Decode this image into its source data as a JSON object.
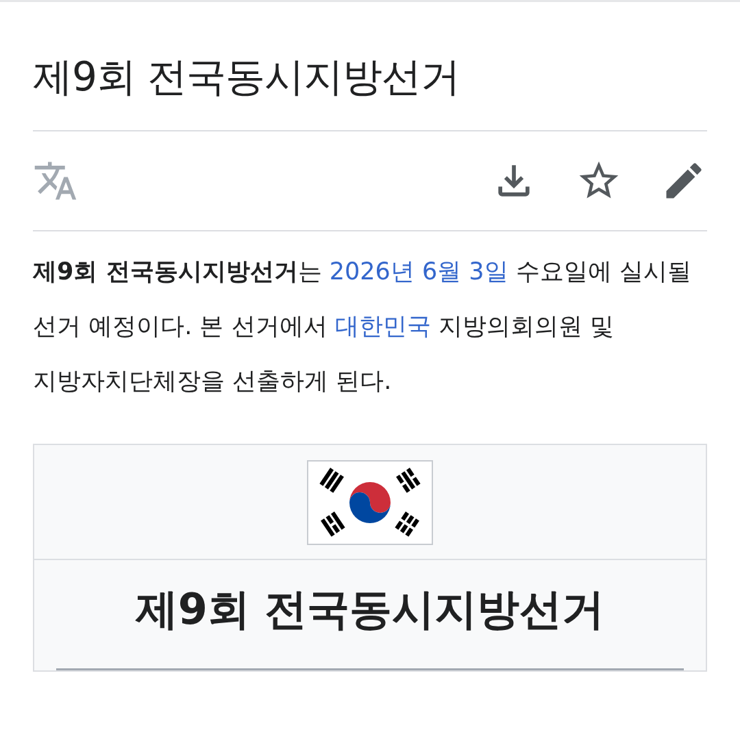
{
  "page_title": "제9회 전국동시지방선거",
  "toolbar": {
    "actions": [
      {
        "kind": "download"
      },
      {
        "kind": "star"
      },
      {
        "kind": "edit"
      }
    ]
  },
  "lead": [
    {
      "kind": "bold",
      "text": "제9회 전국동시지방선거"
    },
    {
      "kind": "text",
      "text": "는 "
    },
    {
      "kind": "link",
      "text": "2026년 6월 3일"
    },
    {
      "kind": "text",
      "text": " 수요일에 실시될 선거 예정이다. 본 선거에서 "
    },
    {
      "kind": "link",
      "text": "대한민국"
    },
    {
      "kind": "text",
      "text": " 지방의회의원 및 지방자치단체장을 선출하게 된다."
    }
  ],
  "infobox": {
    "title": "제9회 전국동시지방선거"
  }
}
